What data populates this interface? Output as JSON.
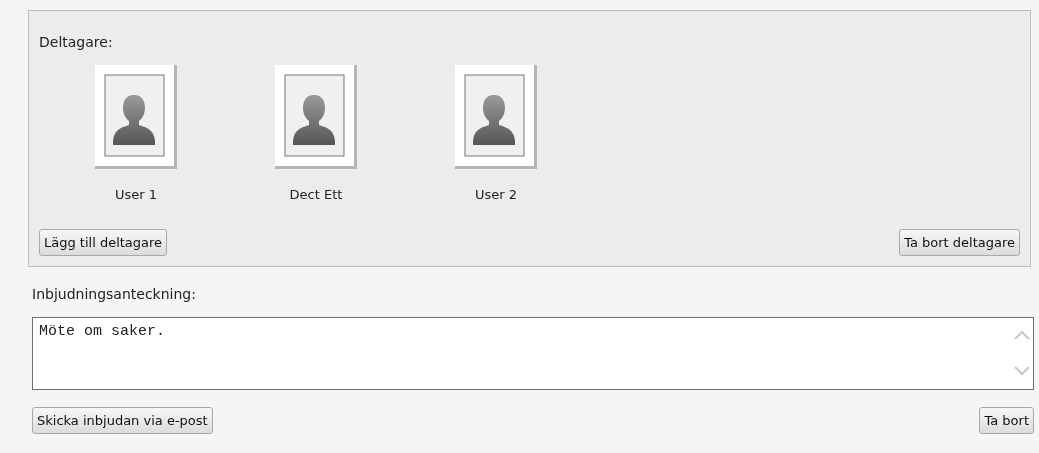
{
  "participants": {
    "label": "Deltagare:",
    "items": [
      {
        "name": "User 1"
      },
      {
        "name": "Dect Ett"
      },
      {
        "name": "User 2"
      }
    ],
    "add_button": "Lägg till deltagare",
    "remove_button": "Ta bort deltagare"
  },
  "note": {
    "label": "Inbjudningsanteckning:",
    "value": "Möte om saker."
  },
  "buttons": {
    "send": "Skicka inbjudan via e-post",
    "remove": "Ta bort"
  }
}
